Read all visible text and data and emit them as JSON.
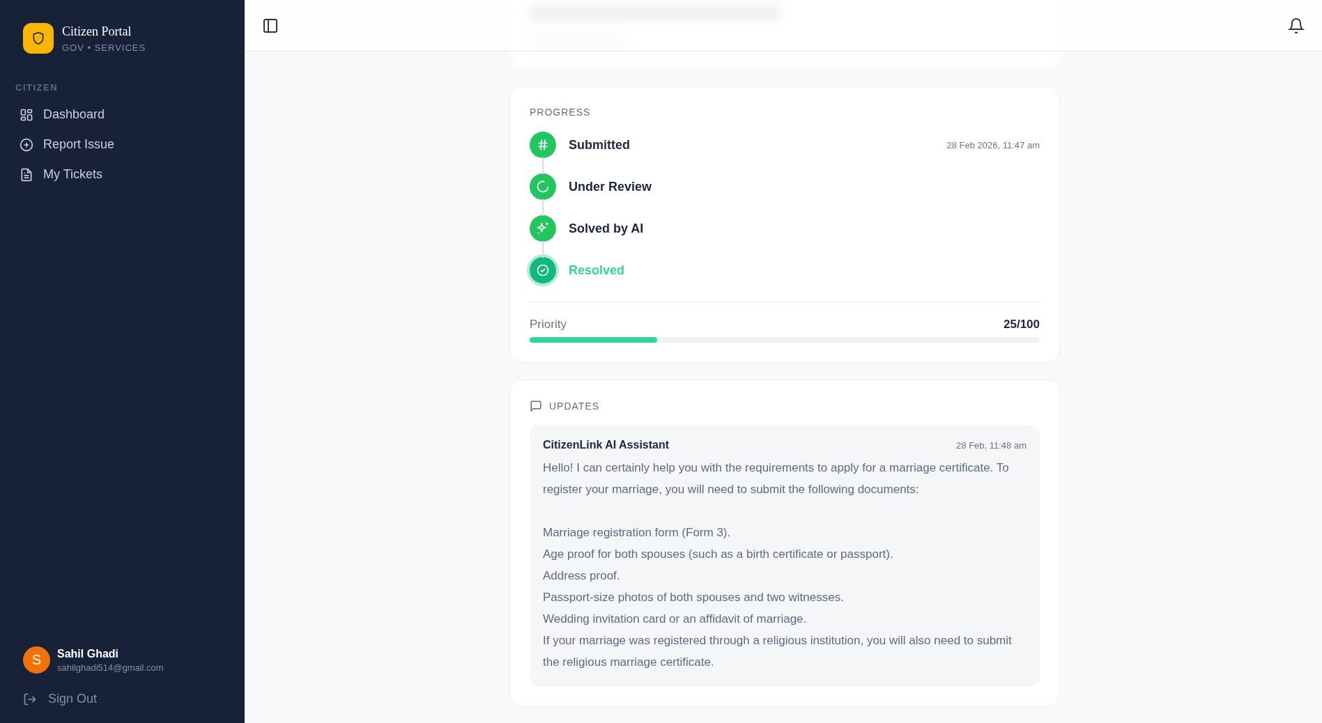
{
  "sidebar": {
    "brand": {
      "title": "Citizen Portal",
      "subtitle": "GOV • SERVICES"
    },
    "section_label": "CITIZEN",
    "items": [
      {
        "kind": "dashboard",
        "label": "Dashboard",
        "selected": false
      },
      {
        "kind": "report",
        "label": "Report Issue",
        "selected": false
      },
      {
        "kind": "tickets",
        "label": "My Tickets",
        "selected": false
      }
    ],
    "user": {
      "initial": "S",
      "name": "Sahil Ghadi",
      "email": "sahilghadi514@gmail.com"
    },
    "sign_out": "Sign Out"
  },
  "progress": {
    "title": "PROGRESS",
    "steps": [
      {
        "kind": "submitted",
        "label": "Submitted",
        "time": "28 Feb 2026, 11:47 am",
        "current": false
      },
      {
        "kind": "review",
        "label": "Under Review",
        "current": false
      },
      {
        "kind": "ai",
        "label": "Solved by AI",
        "current": false
      },
      {
        "kind": "resolved",
        "label": "Resolved",
        "current": true
      }
    ],
    "priority": {
      "label": "Priority",
      "value": "25/100",
      "level": 0.25
    }
  },
  "updates": {
    "title": "UPDATES",
    "messages": [
      {
        "author": "CitizenLink AI Assistant",
        "time": "28 Feb, 11:48 am",
        "intro": "Hello! I can certainly help you with the requirements to apply for a marriage certificate. To register your marriage, you will need to submit the following documents:",
        "lines": [
          "Marriage registration form (Form 3).",
          "Age proof for both spouses (such as a birth certificate or passport).",
          "Address proof.",
          "Passport-size photos of both spouses and two witnesses.",
          "Wedding invitation card or an affidavit of marriage.",
          "If your marriage was registered through a religious institution, you will also need to submit the religious marriage certificate."
        ]
      }
    ]
  }
}
